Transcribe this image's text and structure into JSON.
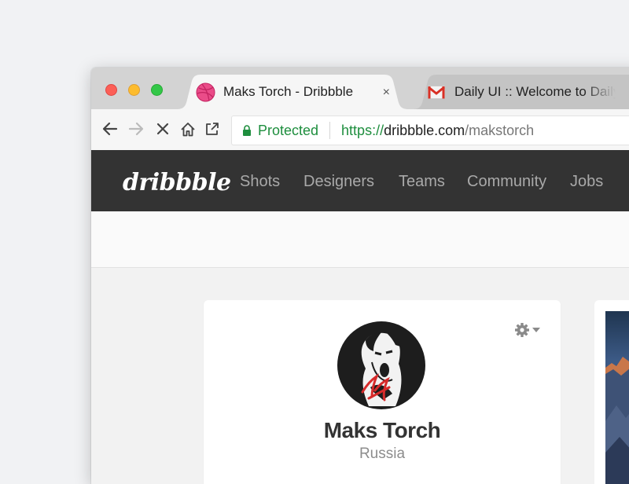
{
  "tabs": [
    {
      "title": "Maks Torch - Dribbble",
      "close": "×",
      "favicon": "dribbble-icon",
      "active": true
    },
    {
      "title": "Daily UI :: Welcome to Daily UI",
      "close": "×",
      "favicon": "gmail-icon",
      "active": false
    }
  ],
  "address": {
    "secure_label": "Protected",
    "scheme": "https://",
    "host": "dribbble.com",
    "path": "/makstorch"
  },
  "site": {
    "logo": "dribbble",
    "nav": [
      "Shots",
      "Designers",
      "Teams",
      "Community",
      "Jobs"
    ]
  },
  "profile": {
    "name": "Maks Torch",
    "location": "Russia"
  },
  "colors": {
    "dribbble_pink": "#ea4c89",
    "nav_bg": "#333333",
    "secure_green": "#1e8e3e"
  }
}
